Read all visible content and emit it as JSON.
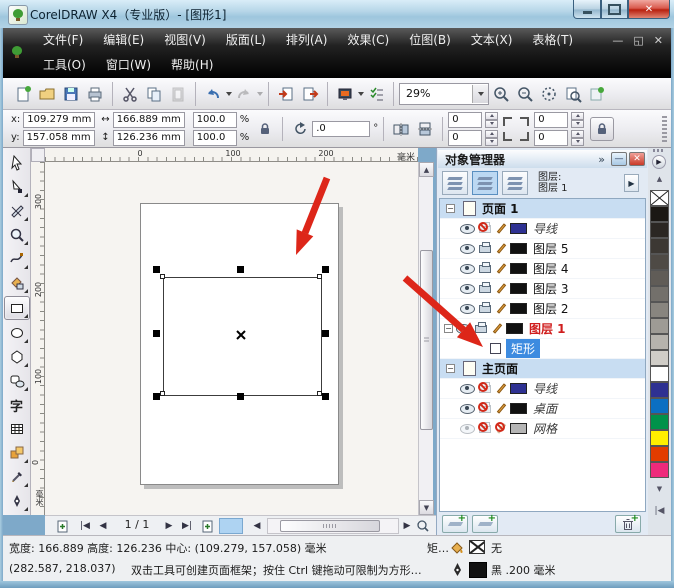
{
  "win": {
    "title": "CorelDRAW X4（专业版）- [图形1]"
  },
  "menu": {
    "row1": [
      "文件(F)",
      "编辑(E)",
      "视图(V)",
      "版面(L)",
      "排列(A)",
      "效果(C)",
      "位图(B)",
      "文本(X)",
      "表格(T)"
    ],
    "row2": [
      "工具(O)",
      "窗口(W)",
      "帮助(H)"
    ]
  },
  "stdbar": {
    "zoom_level": "29%"
  },
  "propbar": {
    "x_label": "x:",
    "x_value": "109.279 mm",
    "y_label": "y:",
    "y_value": "157.058 mm",
    "width_value": "166.889 mm",
    "height_value": "126.236 mm",
    "scale_x": "100.0",
    "scale_y": "100.0",
    "percent": "%",
    "rotation": ".0",
    "degree": "°",
    "corner_t": "0",
    "corner_b": "0",
    "corner_t2": "0",
    "corner_b2": "0"
  },
  "rulers": {
    "h_ticks": [
      "0",
      "100",
      "200"
    ],
    "v_ticks": [
      "300",
      "200",
      "100",
      "0"
    ],
    "unit": "毫米"
  },
  "pagenav": {
    "page_indicator": "1 / 1"
  },
  "docker": {
    "title": "对象管理器",
    "chevron": "»",
    "layer_label": "图层:",
    "layer_current": "图层 1",
    "tree": [
      {
        "label": "页面 1"
      },
      {
        "label": "导线"
      },
      {
        "label": "图层 5"
      },
      {
        "label": "图层 4"
      },
      {
        "label": "图层 3"
      },
      {
        "label": "图层 2"
      },
      {
        "label": "图层 1"
      },
      {
        "label": "矩形"
      },
      {
        "label": "主页面"
      },
      {
        "label": "导线"
      },
      {
        "label": "桌面"
      },
      {
        "label": "网格"
      }
    ]
  },
  "palette": {
    "colors": [
      "#1b1814",
      "#2b2723",
      "#3c3833",
      "#4e4a45",
      "#605c57",
      "#73706b",
      "#88857f",
      "#9e9b95",
      "#b6b3ad",
      "#d0cdc7",
      "#ffffff",
      "#2e3192",
      "#0b6fc2",
      "#00924a",
      "#ffef00",
      "#e23c00",
      "#ee2a7b"
    ],
    "accent_selected": "#3d8be0",
    "layer1_red": "#cf1d1d",
    "guide_swatch": "#2e3192",
    "layer_swatch": "#111111",
    "grid_swatch": "#b5b5b5"
  },
  "statusbar": {
    "line1": "宽度: 166.889 高度: 126.236 中心: (109.279, 157.058) 毫米",
    "object_info": "矩…",
    "fill_none": "无",
    "coords": "(282.587, 218.037)",
    "hint": "双击工具可创建页面框架；按住 Ctrl 键拖动可限制为方形…",
    "outline_info": "黑 .200 毫米"
  }
}
